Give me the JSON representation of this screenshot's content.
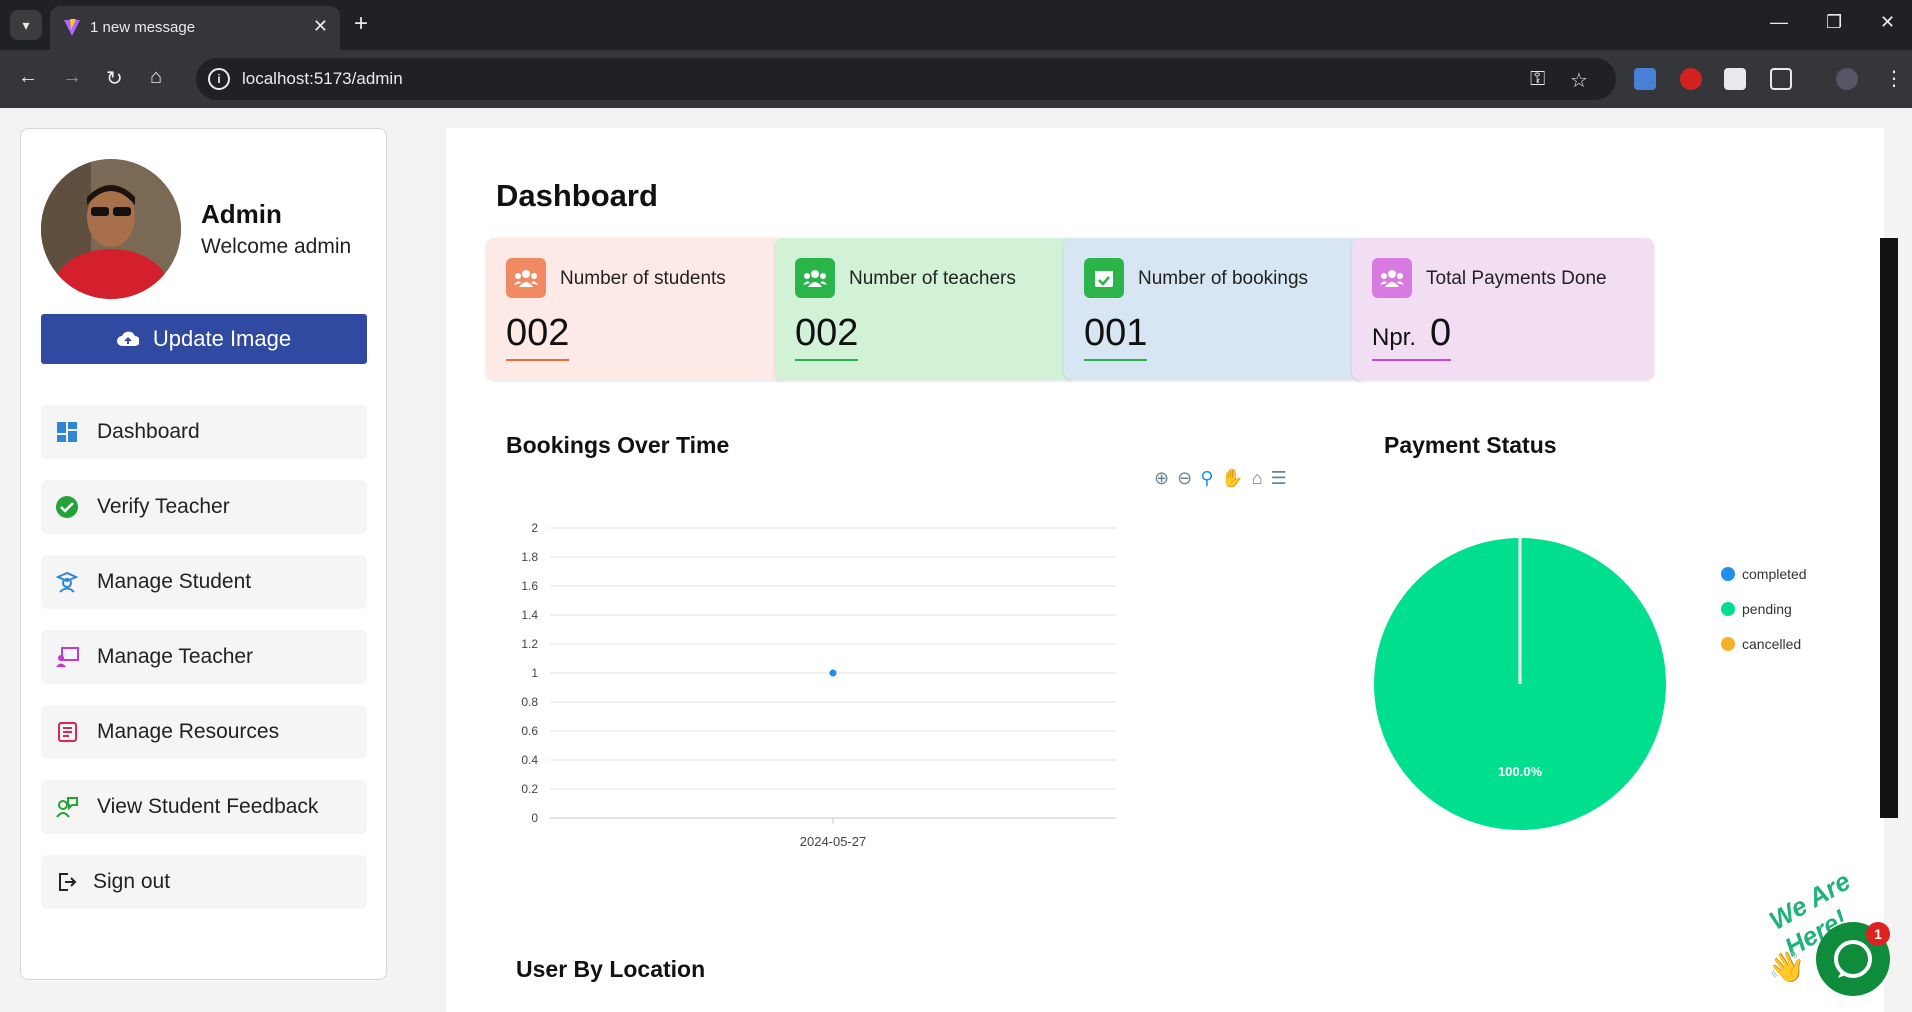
{
  "browser": {
    "tab_title": "1 new message",
    "url": "localhost:5173/admin"
  },
  "sidebar": {
    "name": "Admin",
    "welcome": "Welcome admin",
    "update_button": "Update Image",
    "items": [
      {
        "label": "Dashboard",
        "icon": "dashboard-icon",
        "color": "#2f86d6"
      },
      {
        "label": "Verify Teacher",
        "icon": "check-circle-icon",
        "color": "#23a238"
      },
      {
        "label": "Manage Student",
        "icon": "student-icon",
        "color": "#2f86d6"
      },
      {
        "label": "Manage Teacher",
        "icon": "teacher-icon",
        "color": "#c23bcf"
      },
      {
        "label": "Manage Resources",
        "icon": "newspaper-icon",
        "color": "#d6295b"
      },
      {
        "label": "View Student Feedback",
        "icon": "feedback-icon",
        "color": "#23a238"
      },
      {
        "label": "Sign out",
        "icon": "sign-out-icon",
        "color": "#222222"
      }
    ]
  },
  "main": {
    "title": "Dashboard",
    "cards": [
      {
        "label": "Number of students",
        "value": "002",
        "prefix": "",
        "bg": "#fdeae7",
        "icon_bg": "#f08a62",
        "underline": "#f06a3c",
        "icon": "users-icon"
      },
      {
        "label": "Number of teachers",
        "value": "002",
        "prefix": "",
        "bg": "#d2f2d7",
        "icon_bg": "#2bb44a",
        "underline": "#2bb44a",
        "icon": "users-icon"
      },
      {
        "label": "Number of bookings",
        "value": "001",
        "prefix": "",
        "bg": "#d8e6f3",
        "icon_bg": "#2bb44a",
        "underline": "#2bb44a",
        "icon": "calendar-check-icon"
      },
      {
        "label": "Total Payments Done",
        "value": "0",
        "prefix": "Npr.",
        "bg": "#f1def3",
        "icon_bg": "#d97ae3",
        "underline": "#c64ad6",
        "icon": "users-icon"
      }
    ],
    "bookings_title": "Bookings Over Time",
    "payment_title": "Payment Status",
    "location_title": "User By Location"
  },
  "chart_data": [
    {
      "type": "scatter",
      "title": "Bookings Over Time",
      "x": [
        "2024-05-27"
      ],
      "y": [
        1
      ],
      "ylim": [
        0,
        2
      ],
      "y_ticks": [
        "0",
        "0.2",
        "0.4",
        "0.6",
        "0.8",
        "1",
        "1.2",
        "1.4",
        "1.6",
        "1.8",
        "2"
      ],
      "x_ticks": [
        "2024-05-27"
      ],
      "grid": true,
      "color": "#1f8ef1"
    },
    {
      "type": "pie",
      "title": "Payment Status",
      "categories": [
        "completed",
        "pending",
        "cancelled"
      ],
      "values": [
        0,
        100,
        0
      ],
      "labels": [
        "",
        "100.0%",
        ""
      ],
      "colors": [
        "#1f8ef1",
        "#00df8e",
        "#f4b128"
      ],
      "legend": "right"
    }
  ],
  "chat": {
    "badge": "1",
    "greeting": "We Are Here!"
  }
}
